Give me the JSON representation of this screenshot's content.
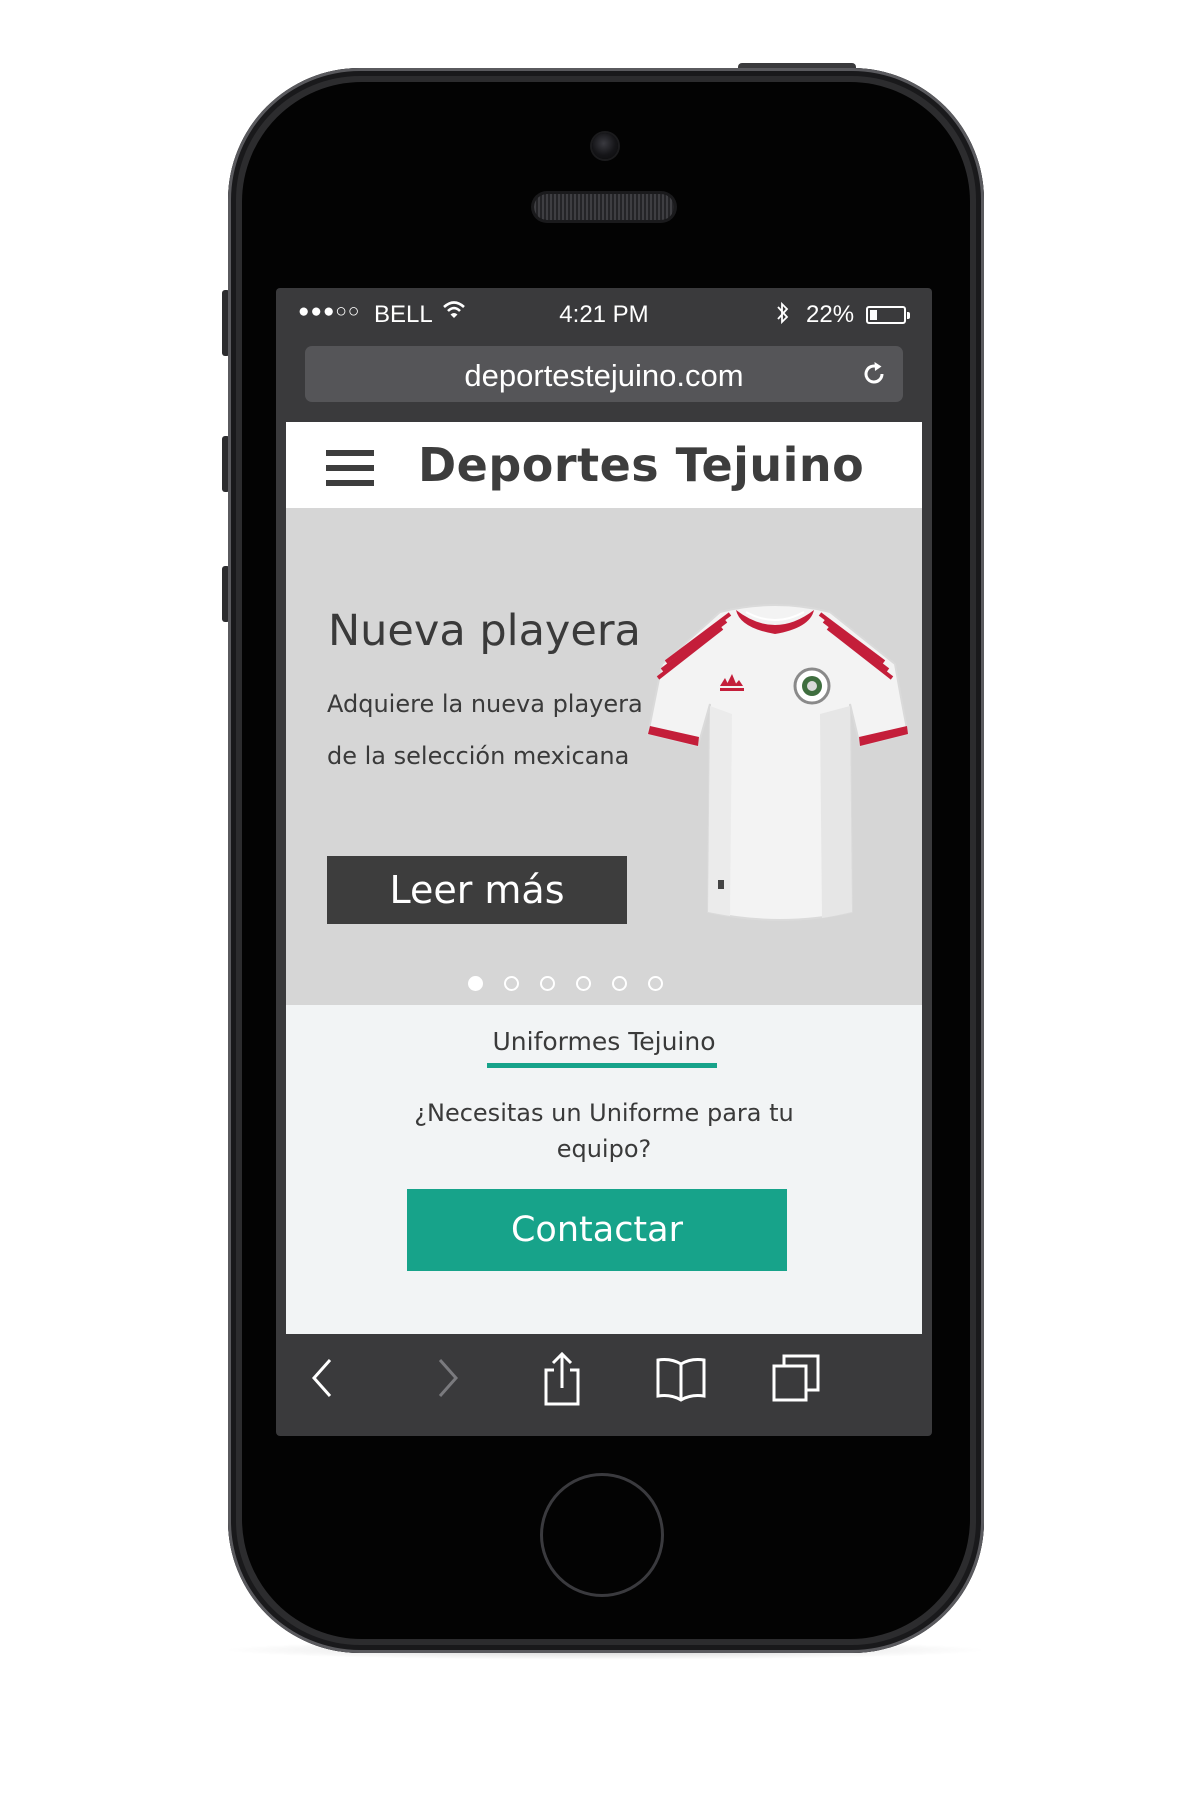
{
  "status_bar": {
    "signal": "●●●○○",
    "carrier": "BELL",
    "time": "4:21 PM",
    "battery_percent": "22%",
    "battery_level": 0.22
  },
  "browser": {
    "url": "deportestejuino.com"
  },
  "site": {
    "title": "Deportes Tejuino"
  },
  "hero": {
    "title": "Nueva playera",
    "description": "Adquiere la nueva  playera de la selección mexicana",
    "button_label": "Leer más",
    "slide_count": 6,
    "active_slide": 1
  },
  "uniform_section": {
    "heading": "Uniformes Tejuino",
    "text": "¿Necesitas un Uniforme para tu equipo?",
    "button_label": "Contactar"
  },
  "toolbar": {
    "icons": [
      "back-icon",
      "forward-icon",
      "share-icon",
      "bookmarks-icon",
      "tabs-icon"
    ]
  },
  "colors": {
    "accent": "#17a38a",
    "dark_button": "#3d3d3d",
    "hero_background": "#d6d6d6",
    "shirt_trim": "#c41e3a"
  }
}
